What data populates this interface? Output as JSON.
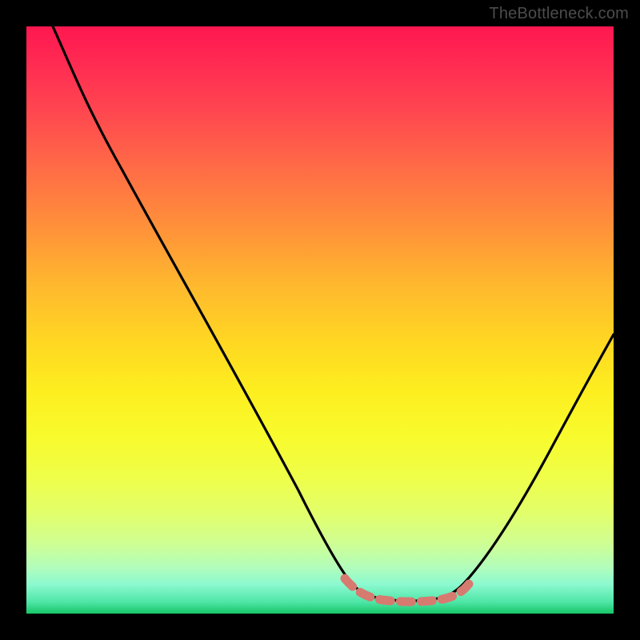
{
  "watermark": "TheBottleneck.com",
  "chart_data": {
    "type": "line",
    "title": "",
    "xlabel": "",
    "ylabel": "",
    "xlim": [
      0,
      100
    ],
    "ylim": [
      0,
      100
    ],
    "grid": false,
    "series": [
      {
        "name": "bottleneck-curve",
        "x": [
          4.5,
          10,
          20,
          30,
          40,
          50,
          53,
          55,
          58,
          62,
          66,
          70,
          73,
          80,
          90,
          100
        ],
        "y": [
          100,
          89,
          71,
          54,
          38,
          19,
          12,
          8,
          4,
          2,
          2,
          3,
          5,
          12,
          28,
          46
        ]
      }
    ],
    "annotations": [
      {
        "name": "valley-marker",
        "x_range": [
          55,
          73
        ],
        "y": 3
      }
    ],
    "background_gradient": {
      "orientation": "vertical",
      "stops": [
        {
          "pos": 0.0,
          "color": "#ff1750"
        },
        {
          "pos": 0.5,
          "color": "#ffd822"
        },
        {
          "pos": 0.8,
          "color": "#e2ff6b"
        },
        {
          "pos": 1.0,
          "color": "#17c667"
        }
      ]
    }
  }
}
